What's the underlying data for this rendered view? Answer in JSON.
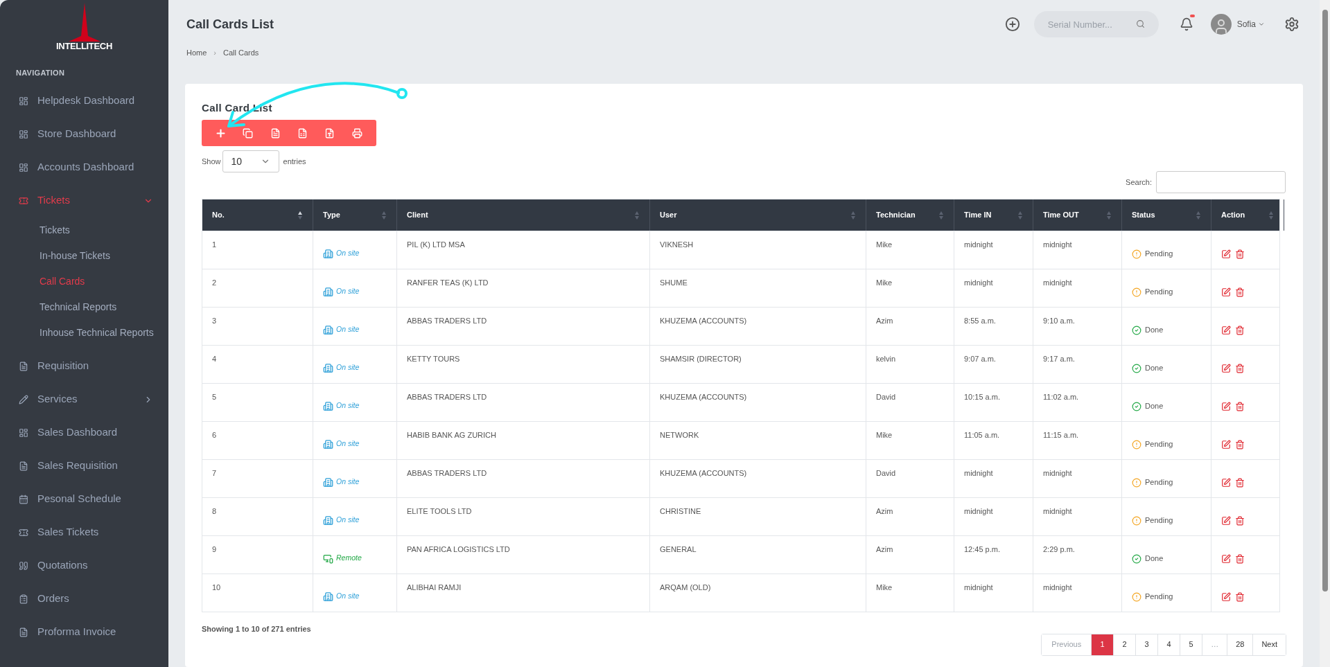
{
  "brand": "INTELLITECH",
  "sidebar": {
    "heading": "NAVIGATION",
    "items": [
      {
        "label": "Helpdesk Dashboard",
        "selected": false
      },
      {
        "label": "Store Dashboard",
        "selected": false
      },
      {
        "label": "Accounts Dashboard",
        "selected": false
      },
      {
        "label": "Tickets",
        "selected": true,
        "expanded": true,
        "children": [
          {
            "label": "Tickets",
            "selected": false
          },
          {
            "label": "In-house Tickets",
            "selected": false
          },
          {
            "label": "Call Cards",
            "selected": true
          },
          {
            "label": "Technical Reports",
            "selected": false
          },
          {
            "label": "Inhouse Technical Reports",
            "selected": false
          }
        ]
      },
      {
        "label": "Requisition",
        "selected": false
      },
      {
        "label": "Services",
        "selected": false,
        "expanded": false
      },
      {
        "label": "Sales Dashboard",
        "selected": false
      },
      {
        "label": "Sales Requisition",
        "selected": false
      },
      {
        "label": "Pesonal Schedule",
        "selected": false
      },
      {
        "label": "Sales Tickets",
        "selected": false
      },
      {
        "label": "Quotations",
        "selected": false
      },
      {
        "label": "Orders",
        "selected": false
      },
      {
        "label": "Proforma Invoice",
        "selected": false
      }
    ]
  },
  "header": {
    "title": "Call Cards List",
    "search_placeholder": "Serial Number...",
    "notification": true,
    "user": "Sofia"
  },
  "breadcrumb": [
    "Home",
    "›",
    "Call Cards"
  ],
  "card": {
    "title": "Call Card List",
    "show_label": "Show",
    "page_size": "10",
    "entries_label": "entries",
    "search_label": "Search:",
    "columns": [
      {
        "label": "No.",
        "sorted": true
      },
      {
        "label": "Type",
        "sorted": false
      },
      {
        "label": "Client",
        "sorted": false
      },
      {
        "label": "User",
        "sorted": false
      },
      {
        "label": "Technician",
        "sorted": false
      },
      {
        "label": "Time IN",
        "sorted": false
      },
      {
        "label": "Time OUT",
        "sorted": false
      },
      {
        "label": "Status",
        "sorted": false
      },
      {
        "label": "Action",
        "sorted": false
      }
    ],
    "rows": [
      {
        "no": "1",
        "type": "On site",
        "remote": false,
        "client": "PIL (K) LTD MSA",
        "user": "VIKNESH",
        "technician": "Mike",
        "time_in": "midnight",
        "time_out": "midnight",
        "status": "Pending",
        "done": false
      },
      {
        "no": "2",
        "type": "On site",
        "remote": false,
        "client": "RANFER TEAS (K) LTD",
        "user": "SHUME",
        "technician": "Mike",
        "time_in": "midnight",
        "time_out": "midnight",
        "status": "Pending",
        "done": false
      },
      {
        "no": "3",
        "type": "On site",
        "remote": false,
        "client": "ABBAS TRADERS LTD",
        "user": "KHUZEMA (ACCOUNTS)",
        "technician": "Azim",
        "time_in": "8:55 a.m.",
        "time_out": "9:10 a.m.",
        "status": "Done",
        "done": true
      },
      {
        "no": "4",
        "type": "On site",
        "remote": false,
        "client": "KETTY TOURS",
        "user": "SHAMSIR (DIRECTOR)",
        "technician": "kelvin",
        "time_in": "9:07 a.m.",
        "time_out": "9:17 a.m.",
        "status": "Done",
        "done": true
      },
      {
        "no": "5",
        "type": "On site",
        "remote": false,
        "client": "ABBAS TRADERS LTD",
        "user": "KHUZEMA (ACCOUNTS)",
        "technician": "David",
        "time_in": "10:15 a.m.",
        "time_out": "11:02 a.m.",
        "status": "Done",
        "done": true
      },
      {
        "no": "6",
        "type": "On site",
        "remote": false,
        "client": "HABIB BANK AG ZURICH",
        "user": "NETWORK",
        "technician": "Mike",
        "time_in": "11:05 a.m.",
        "time_out": "11:15 a.m.",
        "status": "Pending",
        "done": false
      },
      {
        "no": "7",
        "type": "On site",
        "remote": false,
        "client": "ABBAS TRADERS LTD",
        "user": "KHUZEMA (ACCOUNTS)",
        "technician": "David",
        "time_in": "midnight",
        "time_out": "midnight",
        "status": "Pending",
        "done": false
      },
      {
        "no": "8",
        "type": "On site",
        "remote": false,
        "client": "ELITE TOOLS LTD",
        "user": "CHRISTINE",
        "technician": "Azim",
        "time_in": "midnight",
        "time_out": "midnight",
        "status": "Pending",
        "done": false
      },
      {
        "no": "9",
        "type": "Remote",
        "remote": true,
        "client": "PAN AFRICA LOGISTICS LTD",
        "user": "GENERAL",
        "technician": "Azim",
        "time_in": "12:45 p.m.",
        "time_out": "2:29 p.m.",
        "status": "Done",
        "done": true
      },
      {
        "no": "10",
        "type": "On site",
        "remote": false,
        "client": "ALIBHAI RAMJI",
        "user": "ARQAM (OLD)",
        "technician": "Mike",
        "time_in": "midnight",
        "time_out": "midnight",
        "status": "Pending",
        "done": false
      }
    ],
    "info": "Showing 1 to 10 of 271 entries",
    "pagination": [
      {
        "label": "Previous",
        "selected": false,
        "disabled": true
      },
      {
        "label": "1",
        "selected": true,
        "disabled": false
      },
      {
        "label": "2",
        "selected": false,
        "disabled": false
      },
      {
        "label": "3",
        "selected": false,
        "disabled": false
      },
      {
        "label": "4",
        "selected": false,
        "disabled": false
      },
      {
        "label": "5",
        "selected": false,
        "disabled": false
      },
      {
        "label": "…",
        "selected": false,
        "disabled": true
      },
      {
        "label": "28",
        "selected": false,
        "disabled": false
      },
      {
        "label": "Next",
        "selected": false,
        "disabled": false
      }
    ]
  }
}
